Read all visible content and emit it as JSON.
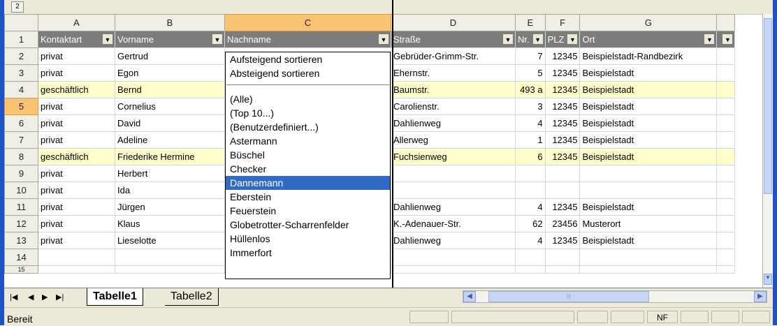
{
  "outline_level": "2",
  "columns": [
    {
      "letter": "A",
      "header": "Kontaktart"
    },
    {
      "letter": "B",
      "header": "Vorname"
    },
    {
      "letter": "C",
      "header": "Nachname"
    },
    {
      "letter": "D",
      "header": "Straße"
    },
    {
      "letter": "E",
      "header": "Nr."
    },
    {
      "letter": "F",
      "header": "PLZ"
    },
    {
      "letter": "G",
      "header": "Ort"
    }
  ],
  "header_row_number": "1",
  "rows": [
    {
      "n": "2",
      "a": "privat",
      "b": "Gertrud",
      "d": "Gebrüder-Grimm-Str.",
      "e": "7",
      "f": "12345",
      "g": "Beispielstadt-Randbezirk"
    },
    {
      "n": "3",
      "a": "privat",
      "b": "Egon",
      "d": "Ehernstr.",
      "e": "5",
      "f": "12345",
      "g": "Beispielstadt"
    },
    {
      "n": "4",
      "a": "geschäftlich",
      "b": "Bernd",
      "d": "Baumstr.",
      "e": "493 a",
      "f": "12345",
      "g": "Beispielstadt"
    },
    {
      "n": "5",
      "a": "privat",
      "b": "Cornelius",
      "d": "Carolienstr.",
      "e": "3",
      "f": "12345",
      "g": "Beispielstadt"
    },
    {
      "n": "6",
      "a": "privat",
      "b": "David",
      "d": "Dahlienweg",
      "e": "4",
      "f": "12345",
      "g": "Beispielstadt"
    },
    {
      "n": "7",
      "a": "privat",
      "b": "Adeline",
      "d": "Allerweg",
      "e": "1",
      "f": "12345",
      "g": "Beispielstadt"
    },
    {
      "n": "8",
      "a": "geschäftlich",
      "b": "Friederike Hermine",
      "d": "Fuchsienweg",
      "e": "6",
      "f": "12345",
      "g": "Beispielstadt"
    },
    {
      "n": "9",
      "a": "privat",
      "b": "Herbert",
      "d": "",
      "e": "",
      "f": "",
      "g": ""
    },
    {
      "n": "10",
      "a": "privat",
      "b": "Ida",
      "d": "",
      "e": "",
      "f": "",
      "g": ""
    },
    {
      "n": "11",
      "a": "privat",
      "b": "Jürgen",
      "d": "Dahlienweg",
      "e": "4",
      "f": "12345",
      "g": "Beispielstadt"
    },
    {
      "n": "12",
      "a": "privat",
      "b": "Klaus",
      "d": "K.-Adenauer-Str.",
      "e": "62",
      "f": "23456",
      "g": "Musterort"
    },
    {
      "n": "13",
      "a": "privat",
      "b": "Lieselotte",
      "d": "Dahlienweg",
      "e": "4",
      "f": "12345",
      "g": "Beispielstadt"
    },
    {
      "n": "14",
      "a": "",
      "b": "",
      "d": "",
      "e": "",
      "f": "",
      "g": ""
    }
  ],
  "partial_row_number": "15",
  "filter_dropdown": {
    "sort_items": [
      "Aufsteigend sortieren",
      "Absteigend sortieren"
    ],
    "filter_items": [
      "(Alle)",
      "(Top 10...)",
      "(Benutzerdefiniert...)",
      "Astermann",
      "Büschel",
      "Checker",
      "Dannemann",
      "Eberstein",
      "Feuerstein",
      "Globetrotter-Scharrenfelder",
      "Hüllenlos",
      "Immerfort"
    ],
    "selected": "Dannemann"
  },
  "sheet_tabs": [
    "Tabelle1",
    "Tabelle2"
  ],
  "active_tab": "Tabelle1",
  "status": {
    "text": "Bereit",
    "indicator": "NF"
  },
  "colors": {
    "highlight_row": "#ffffcc",
    "selected_item": "#316ac5",
    "filter_header": "#7c7c7c",
    "selected_col_header": "#f9c373"
  }
}
